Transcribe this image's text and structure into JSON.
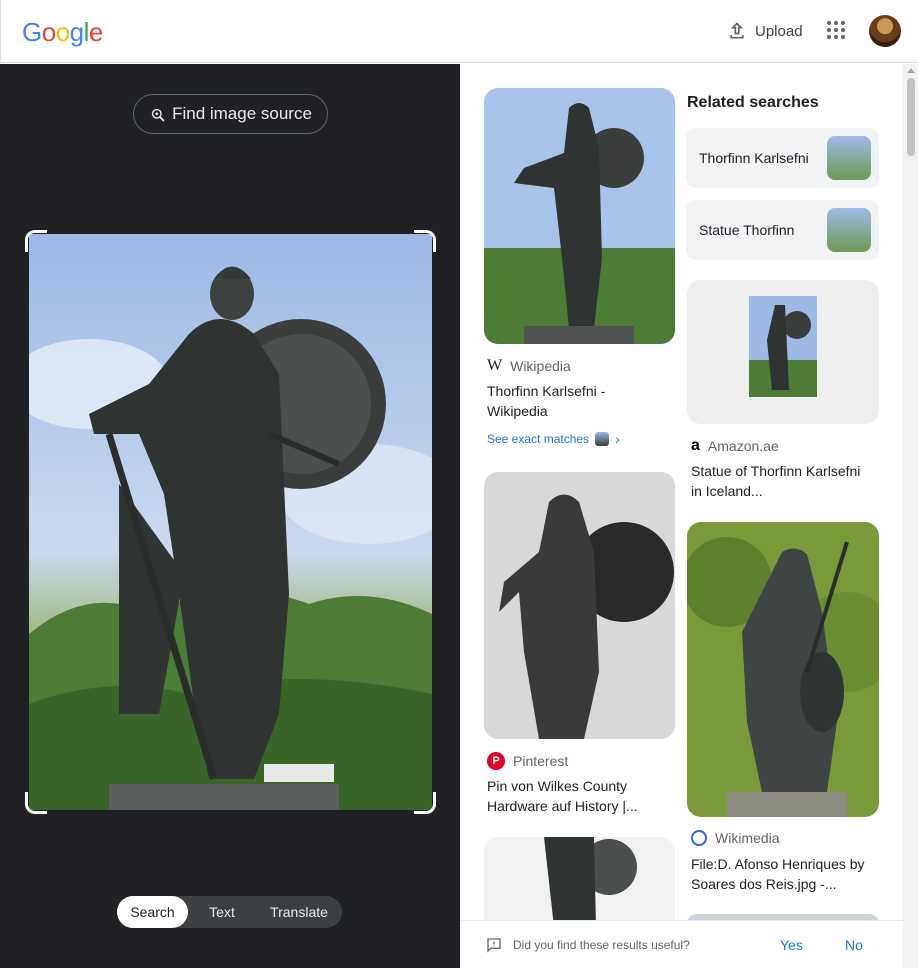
{
  "header": {
    "logo_letters": [
      "G",
      "o",
      "o",
      "g",
      "l",
      "e"
    ],
    "logo_colors": [
      "#4285f4",
      "#ea4335",
      "#fbbc05",
      "#4285f4",
      "#34a853",
      "#ea4335"
    ],
    "upload_label": "Upload"
  },
  "left_panel": {
    "find_source_label": "Find image source",
    "modes": [
      {
        "label": "Search",
        "active": true
      },
      {
        "label": "Text",
        "active": false
      },
      {
        "label": "Translate",
        "active": false
      }
    ]
  },
  "results": {
    "cards": [
      {
        "source": "Wikipedia",
        "title": "Thorfinn Karlsefni - Wikipedia",
        "see_matches": "See exact matches"
      },
      {
        "source": "Amazon.ae",
        "title": "Statue of Thorfinn Karlsefni in Iceland..."
      },
      {
        "source": "Pinterest",
        "title": "Pin von Wilkes County Hardware auf History |..."
      },
      {
        "source": "Wikimedia",
        "title": "File:D. Afonso Henriques by Soares dos Reis.jpg -..."
      }
    ]
  },
  "related": {
    "heading": "Related searches",
    "items": [
      "Thorfinn Karlsefni",
      "Statue Thorfinn"
    ]
  },
  "feedback": {
    "question": "Did you find these results useful?",
    "yes": "Yes",
    "no": "No"
  }
}
